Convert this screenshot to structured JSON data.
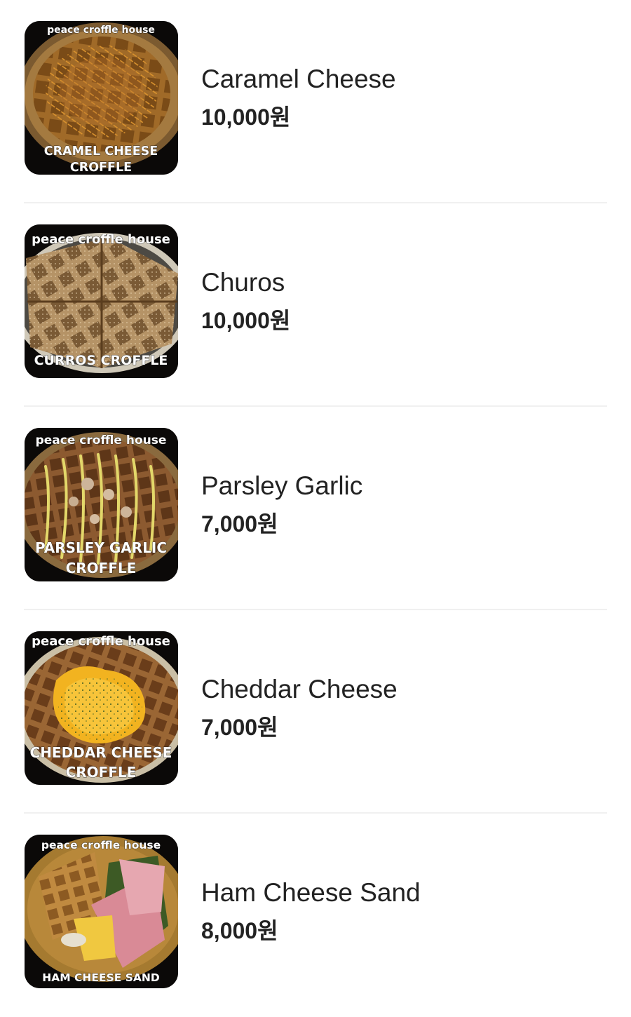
{
  "menu": {
    "items": [
      {
        "name": "Caramel Cheese",
        "price": "10,000원",
        "image": {
          "top_text": "peace croffle house",
          "bottom_line1": "CRAMEL CHEESE",
          "bottom_line2": "CROFFLE"
        }
      },
      {
        "name": "Churos",
        "price": "10,000원",
        "image": {
          "top_text": "peace croffle house",
          "bottom_line1": "CURROS CROFFLE"
        }
      },
      {
        "name": "Parsley Garlic",
        "price": "7,000원",
        "image": {
          "top_text": "peace croffle house",
          "bottom_line1": "PARSLEY GARLIC",
          "bottom_line2": "CROFFLE"
        }
      },
      {
        "name": "Cheddar Cheese",
        "price": "7,000원",
        "image": {
          "top_text": "peace croffle house",
          "bottom_line1": "CHEDDAR CHEESE",
          "bottom_line2": "CROFFLE"
        }
      },
      {
        "name": "Ham Cheese Sand",
        "price": "8,000원",
        "image": {
          "top_text": "peace croffle house",
          "bottom_line1": "HAM CHEESE SAND"
        }
      }
    ]
  },
  "colors": {
    "text": "#222222",
    "divider": "#f0f0f0",
    "background": "#ffffff"
  }
}
